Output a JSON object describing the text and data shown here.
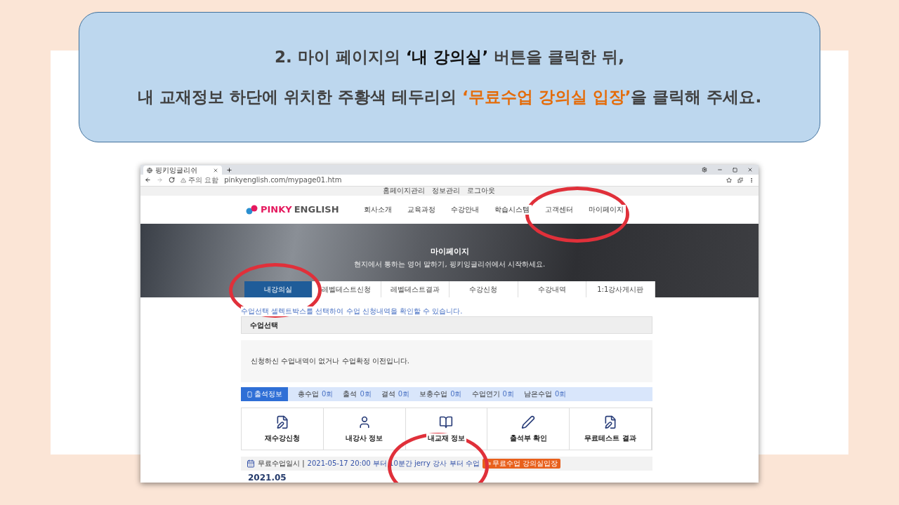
{
  "instruction_lines": [
    {
      "text": "2. 마이 페이지의 **‘내 강의실’** 버튼을 클릭한 뒤,"
    },
    {
      "text": "내 교재정보 하단에 위치한 주황색 테두리의 **‘무료수업 강의실 입장’**을 클릭해 주세요."
    }
  ],
  "browser": {
    "tab_title": "핑키잉글리쉬",
    "security_label": "주의 요함",
    "url": "pinkyenglish.com/mypage01.htm"
  },
  "top_links": [
    "홈페이지관리",
    "정보관리",
    "로그아웃"
  ],
  "logo": {
    "accent": "PINKY",
    "rest": "ENGLISH"
  },
  "nav": [
    "회사소개",
    "교육과정",
    "수강안내",
    "학습시스템",
    "고객센터",
    "마이페이지"
  ],
  "hero": {
    "title": "마이페이지",
    "subtitle": "현지에서 통하는 영어 말하기, 핑키잉글리쉬에서 시작하세요."
  },
  "tabs": [
    {
      "label": "내강의실",
      "selected": true
    },
    {
      "label": "레벨테스트신청",
      "selected": false
    },
    {
      "label": "레벨테스트결과",
      "selected": false
    },
    {
      "label": "수강신청",
      "selected": false
    },
    {
      "label": "수강내역",
      "selected": false
    },
    {
      "label": "1:1강사게시판",
      "selected": false
    }
  ],
  "notice": "수업선택 셀렉트박스를 선택하여 수업 신청내역을 확인할 수 있습니다.",
  "section_title": "수업선택",
  "empty_message": "신청하신 수업내역이 없거나 수업확정 이전입니다.",
  "attendance": {
    "button": "출석정보",
    "stats": [
      {
        "label": "총수업",
        "value": "0회"
      },
      {
        "label": "출석",
        "value": "0회"
      },
      {
        "label": "결석",
        "value": "0회"
      },
      {
        "label": "보충수업",
        "value": "0회"
      },
      {
        "label": "수업연기",
        "value": "0회"
      },
      {
        "label": "남은수업",
        "value": "0회"
      }
    ]
  },
  "menu_cards": [
    {
      "label": "재수강신청",
      "kind": "form"
    },
    {
      "label": "내강사 정보",
      "kind": "teacher"
    },
    {
      "label": "내교재 정보",
      "kind": "book"
    },
    {
      "label": "출석부 확인",
      "kind": "pen"
    },
    {
      "label": "무료테스트 결과",
      "kind": "form"
    }
  ],
  "free_lesson": {
    "label": "무료수업일시 |",
    "schedule": "2021-05-17  20:00 부터 10분간 jerry 강사",
    "suffix": "부터 수업",
    "button": "무료수업 강의실입장"
  },
  "calendar_month": "2021.05"
}
